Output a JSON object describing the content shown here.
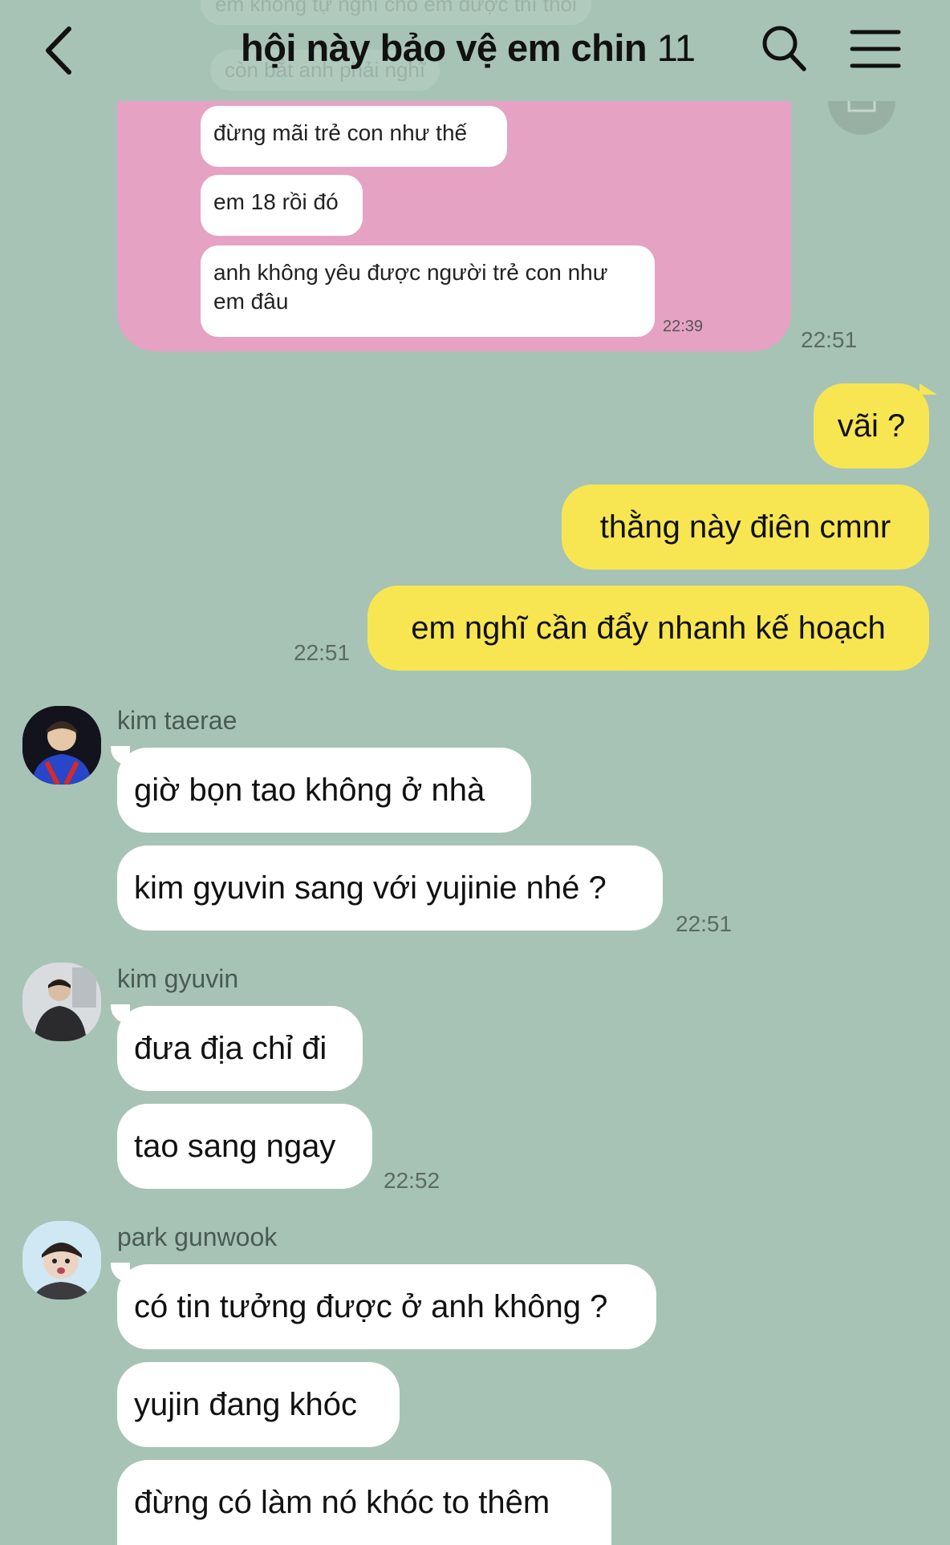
{
  "header": {
    "title": "hội này bảo vệ em chin",
    "member_count": "11",
    "faded_text_1": "em không tự nghĩ cho em được thì thôi",
    "faded_text_2": "còn bắt anh phải nghĩ"
  },
  "screenshot": {
    "messages": [
      "đừng mãi trẻ con như thế",
      "em 18 rồi đó",
      "anh không yêu được người trẻ con như em đâu"
    ],
    "time": "22:39",
    "sent_time": "22:51"
  },
  "my_messages": {
    "items": [
      "vãi ?",
      "thằng này điên cmnr",
      "em nghĩ cần đẩy nhanh kế hoạch"
    ],
    "time": "22:51"
  },
  "groups": [
    {
      "sender": "kim taerae",
      "messages": [
        "giờ bọn tao không ở nhà",
        "kim gyuvin sang với yujinie nhé ?"
      ],
      "time": "22:51"
    },
    {
      "sender": "kim gyuvin",
      "messages": [
        "đưa địa chỉ đi",
        "tao sang ngay"
      ],
      "time": "22:52"
    },
    {
      "sender": "park gunwook",
      "messages": [
        "có tin tưởng được ở anh không ?",
        "yujin đang khóc",
        "đừng có làm nó khóc to thêm"
      ]
    }
  ],
  "colors": {
    "background": "#a7c3b5",
    "my_bubble": "#f7e651",
    "their_bubble": "#ffffff",
    "screenshot_card": "#e5a2c3"
  }
}
